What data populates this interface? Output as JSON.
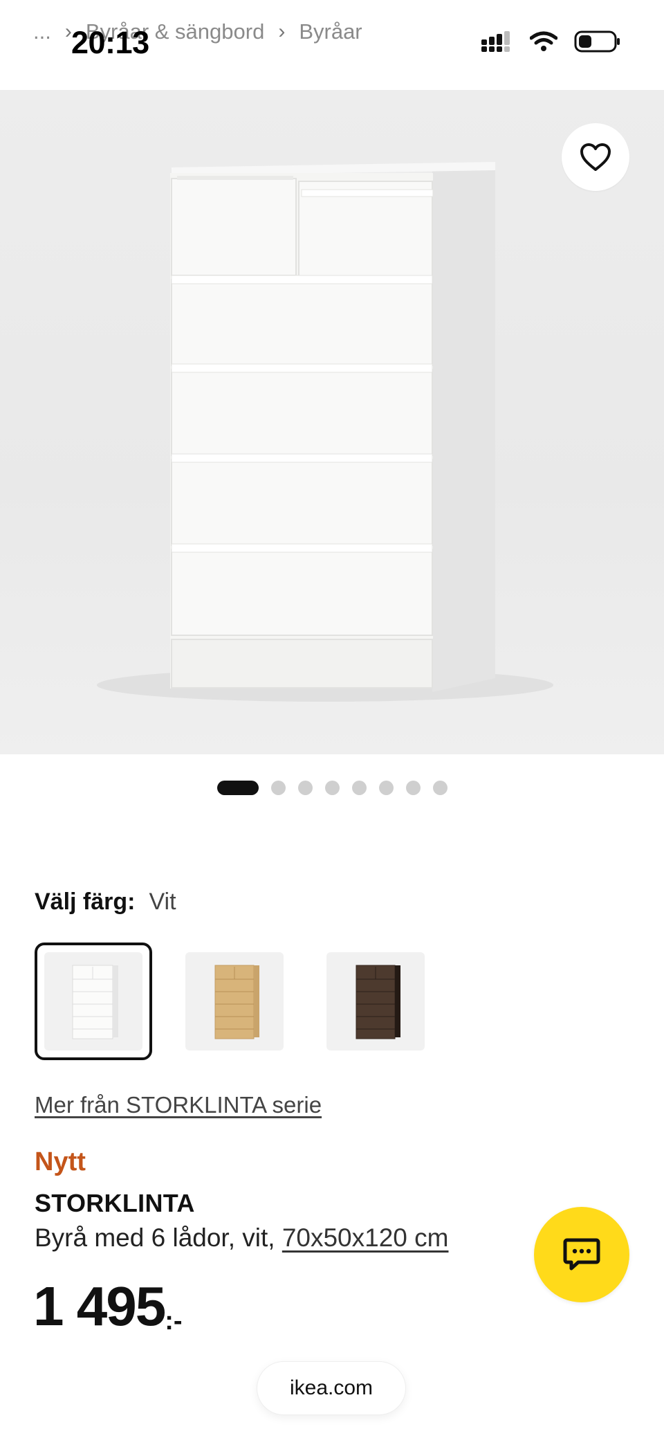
{
  "status_bar": {
    "time": "20:13",
    "icons": [
      "cellular-signal-icon",
      "wifi-icon",
      "battery-icon"
    ]
  },
  "breadcrumb": {
    "items": [
      "...",
      "Byråar & sängbord",
      "Byråar"
    ]
  },
  "gallery": {
    "image_alt": "STORKLINTA Byrå med 6 lådor, vit",
    "dots_total": 8,
    "active_index": 0,
    "favorite_icon": "heart-outline-icon"
  },
  "color_picker": {
    "label": "Välj färg:",
    "selected_value": "Vit",
    "options": [
      {
        "name": "white",
        "color": "#f4f4f2",
        "selected": true
      },
      {
        "name": "oak",
        "color": "#d8b47a",
        "selected": false
      },
      {
        "name": "brown",
        "color": "#4d3a2e",
        "selected": false
      }
    ]
  },
  "series_link": "Mer från STORKLINTA serie",
  "product": {
    "badge": "Nytt",
    "name": "STORKLINTA",
    "description_prefix": "Byrå med 6 lådor, vit, ",
    "dimensions": "70x50x120 cm",
    "price": "1 495",
    "price_suffix": ":-"
  },
  "chat_fab": {
    "icon": "chat-bubble-icon"
  },
  "browser": {
    "url": "ikea.com"
  },
  "colors": {
    "accent_new": "#c4551a",
    "chat_fab": "#ffda1a"
  }
}
